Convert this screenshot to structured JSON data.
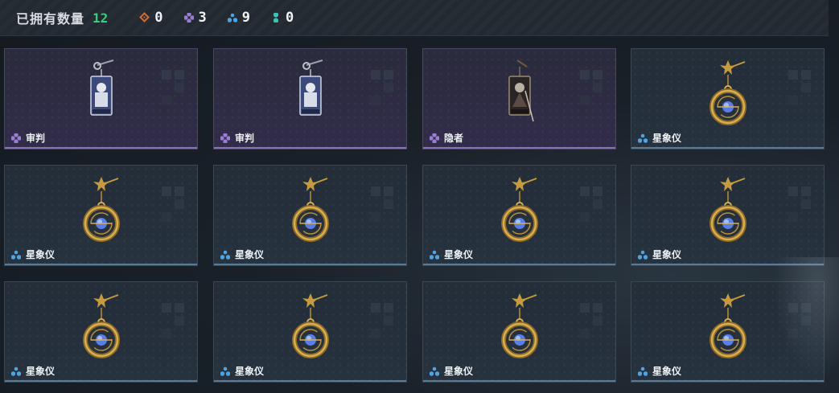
{
  "header": {
    "owned_label": "已拥有数量",
    "owned_count": "12",
    "stats": [
      {
        "icon": "orange-diamond-icon",
        "color": "#c8703f",
        "value": "0"
      },
      {
        "icon": "purple-clover-icon",
        "color": "#9b7cd4",
        "value": "3"
      },
      {
        "icon": "blue-triangle-icon",
        "color": "#4fa3e0",
        "value": "9"
      },
      {
        "icon": "cyan-dots-icon",
        "color": "#39c3b3",
        "value": "0"
      }
    ]
  },
  "cards": [
    {
      "name": "审判",
      "rarity": "purple",
      "art": "tarot-judgement"
    },
    {
      "name": "审判",
      "rarity": "purple",
      "art": "tarot-judgement"
    },
    {
      "name": "隐者",
      "rarity": "purple",
      "art": "tarot-hermit"
    },
    {
      "name": "星象仪",
      "rarity": "blue",
      "art": "astrolabe-pendant"
    },
    {
      "name": "星象仪",
      "rarity": "blue",
      "art": "astrolabe-pendant"
    },
    {
      "name": "星象仪",
      "rarity": "blue",
      "art": "astrolabe-pendant"
    },
    {
      "name": "星象仪",
      "rarity": "blue",
      "art": "astrolabe-pendant"
    },
    {
      "name": "星象仪",
      "rarity": "blue",
      "art": "astrolabe-pendant"
    },
    {
      "name": "星象仪",
      "rarity": "blue",
      "art": "astrolabe-pendant"
    },
    {
      "name": "星象仪",
      "rarity": "blue",
      "art": "astrolabe-pendant"
    },
    {
      "name": "星象仪",
      "rarity": "blue",
      "art": "astrolabe-pendant"
    },
    {
      "name": "星象仪",
      "rarity": "blue",
      "art": "astrolabe-pendant"
    }
  ],
  "colors": {
    "count_green": "#37d07a",
    "purple_rarity": "#9b7cd4",
    "blue_rarity": "#4fa3e0"
  }
}
